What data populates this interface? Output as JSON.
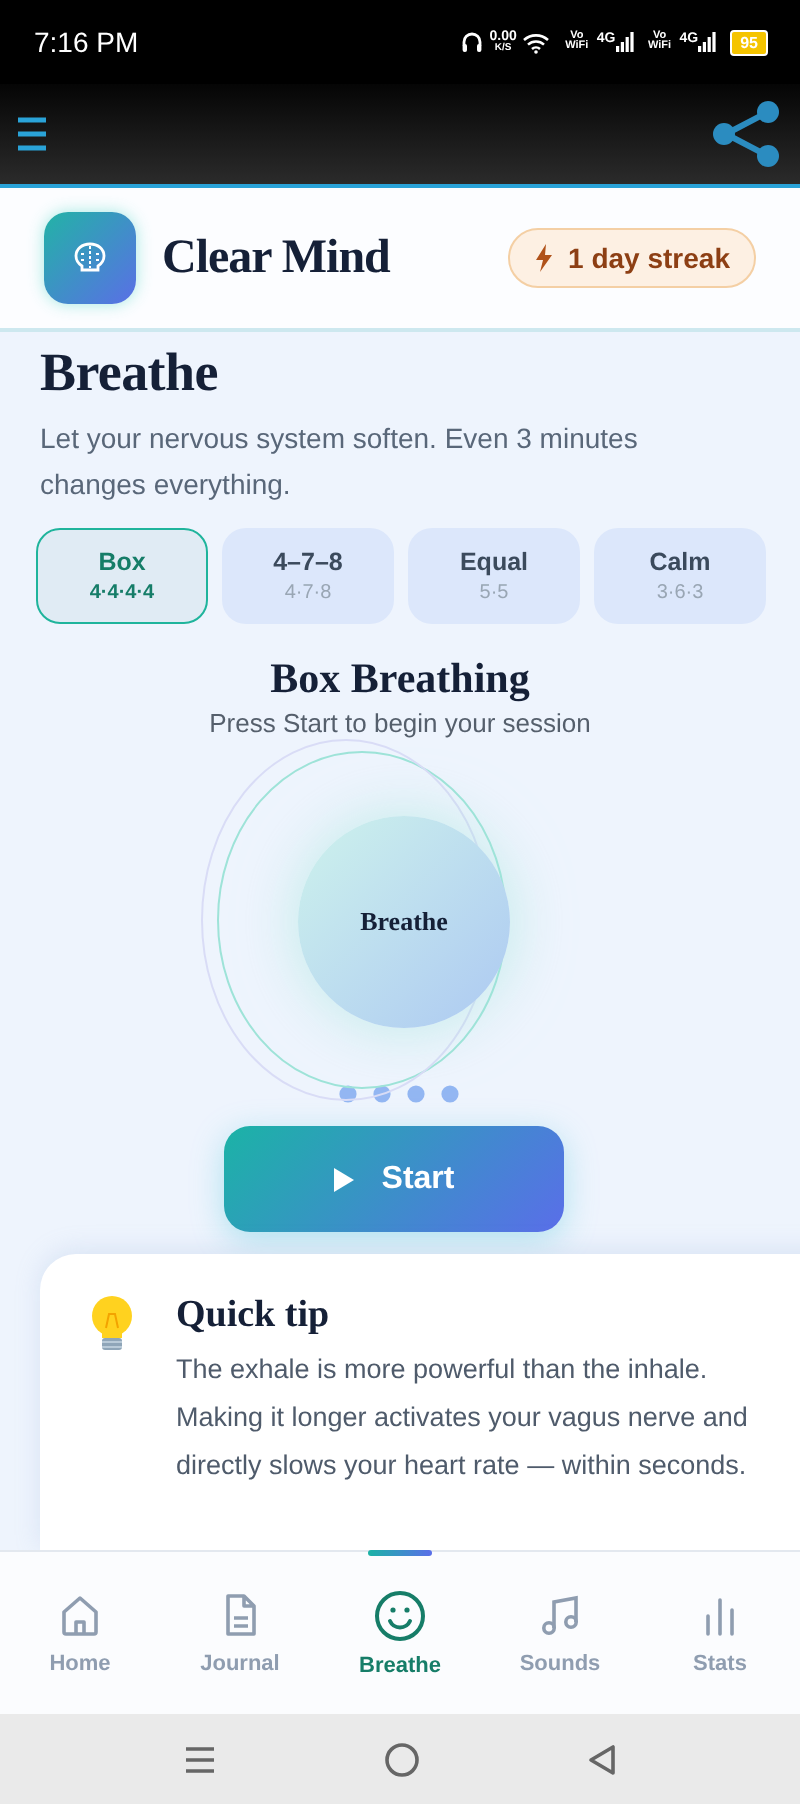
{
  "status_bar": {
    "time": "7:16 PM",
    "speed": "0.00",
    "speed_unit": "K/S",
    "networks": [
      {
        "label": "Vo WiFi",
        "type": "4G"
      },
      {
        "label": "Vo WiFi",
        "type": "4G"
      }
    ],
    "battery": "95"
  },
  "app": {
    "name": "Clear Mind",
    "streak": "1 day streak"
  },
  "page": {
    "title": "Breathe",
    "subtitle": "Let your nervous system soften. Even 3 minutes changes everything."
  },
  "patterns": [
    {
      "label": "Box",
      "timing": "4·4·4·4",
      "selected": true
    },
    {
      "label": "4–7–8",
      "timing": "4·7·8",
      "selected": false
    },
    {
      "label": "Equal",
      "timing": "5·5",
      "selected": false
    },
    {
      "label": "Calm",
      "timing": "3·6·3",
      "selected": false
    }
  ],
  "session": {
    "title": "Box Breathing",
    "hint": "Press Start to begin your session",
    "circle_label": "Breathe",
    "button": "Start"
  },
  "tip": {
    "title": "Quick tip",
    "text": "The exhale is more powerful than the inhale. Making it longer activates your vagus nerve and directly slows your heart rate — within seconds."
  },
  "nav": [
    {
      "kind": "home",
      "label": "Home",
      "selected": false
    },
    {
      "kind": "journal",
      "label": "Journal",
      "selected": false
    },
    {
      "kind": "breathe",
      "label": "Breathe",
      "selected": true
    },
    {
      "kind": "sounds",
      "label": "Sounds",
      "selected": false
    },
    {
      "kind": "stats",
      "label": "Stats",
      "selected": false
    }
  ]
}
